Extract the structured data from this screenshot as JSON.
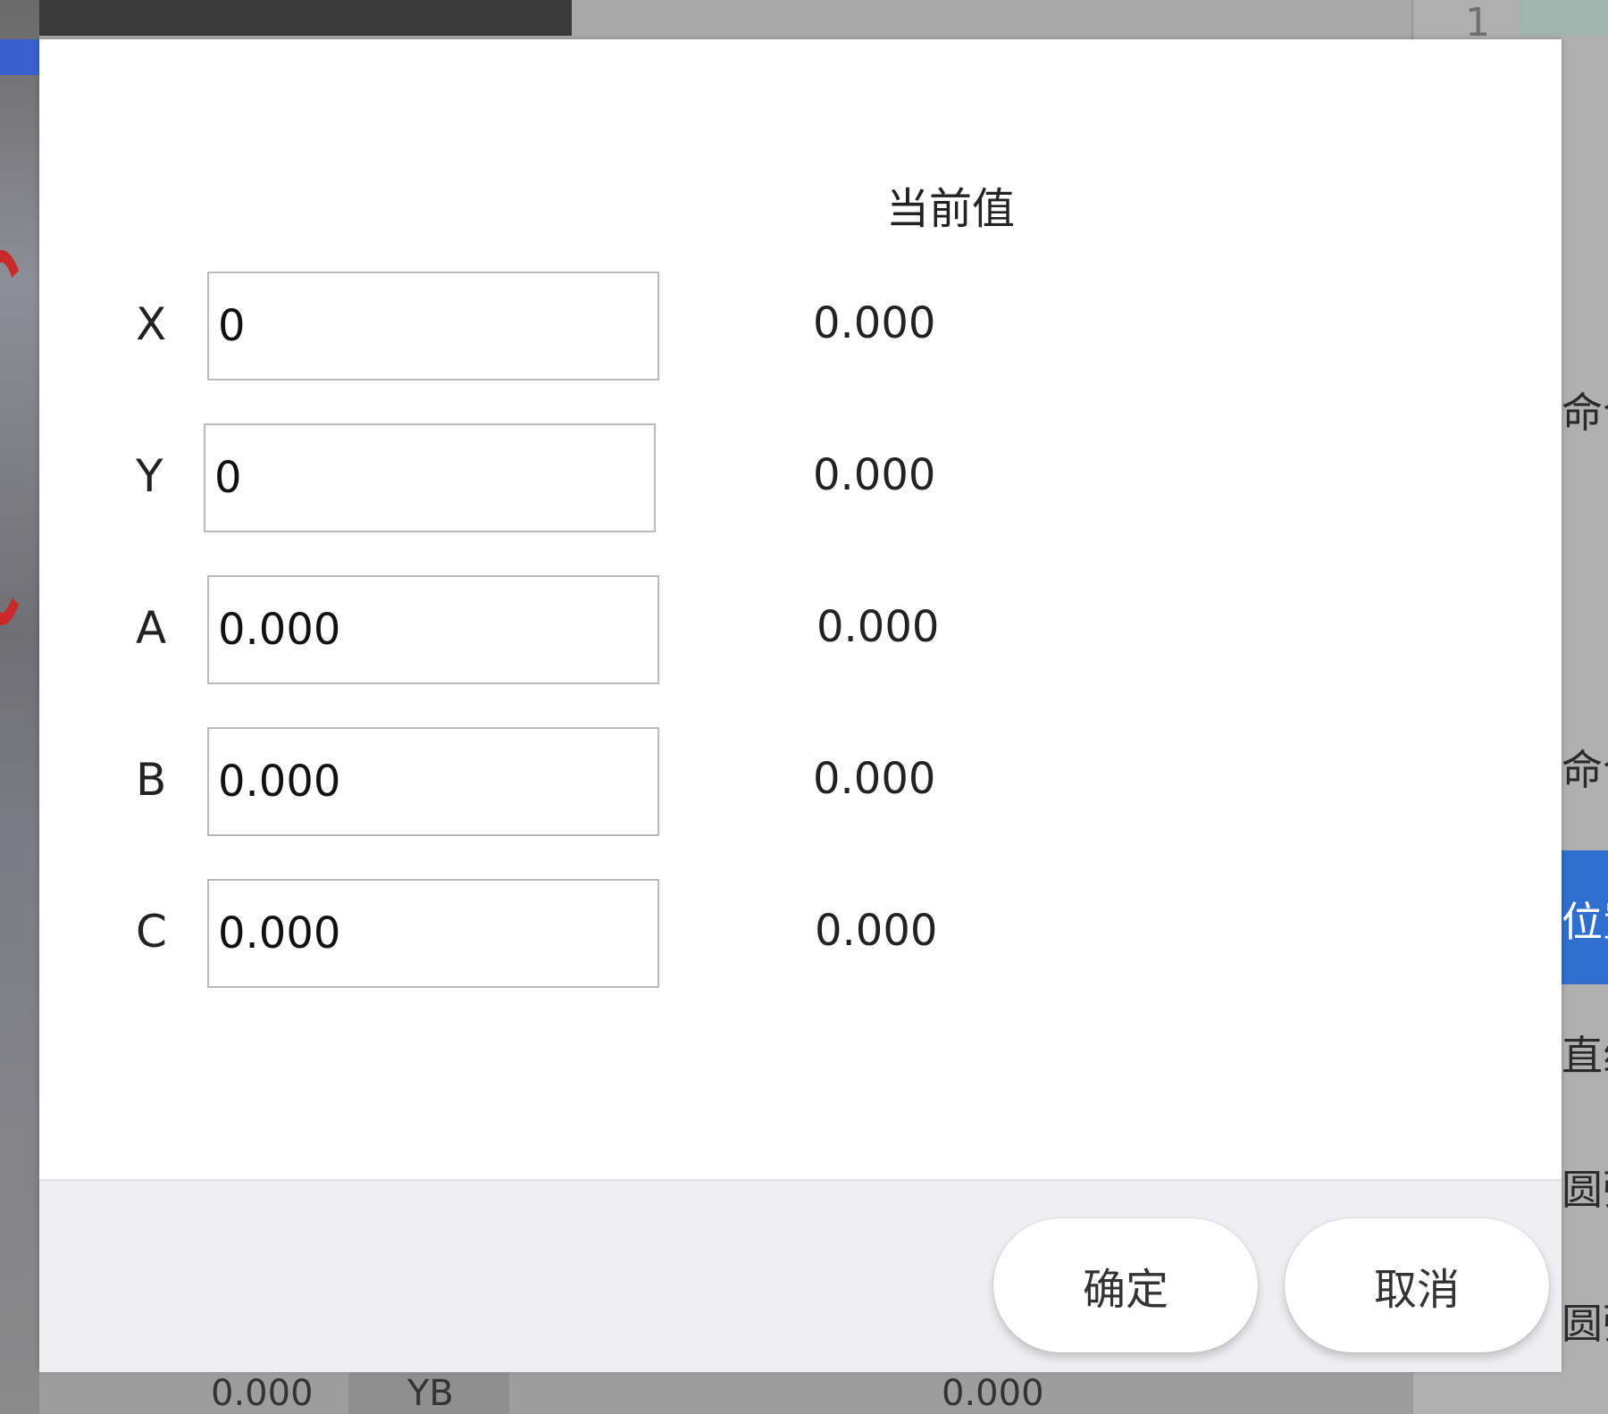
{
  "background": {
    "top_right_number": "1",
    "right_text_1": "命令",
    "right_text_2": "命令",
    "right_text_3": "位置",
    "right_text_4": "直线",
    "right_text_5": "圆弧",
    "right_text_6": "圆弧",
    "bottom_left_value": "0.000",
    "bottom_label": "YB",
    "bottom_right_value": "0.000"
  },
  "dialog": {
    "current_value_header": "当前值",
    "rows": [
      {
        "axis": "X",
        "input_value": "0",
        "current_value": "0.000"
      },
      {
        "axis": "Y",
        "input_value": "0",
        "current_value": "0.000"
      },
      {
        "axis": "A",
        "input_value": "0.000",
        "current_value": "0.000"
      },
      {
        "axis": "B",
        "input_value": "0.000",
        "current_value": "0.000"
      },
      {
        "axis": "C",
        "input_value": "0.000",
        "current_value": "0.000"
      }
    ],
    "ok_label": "确定",
    "cancel_label": "取消"
  }
}
